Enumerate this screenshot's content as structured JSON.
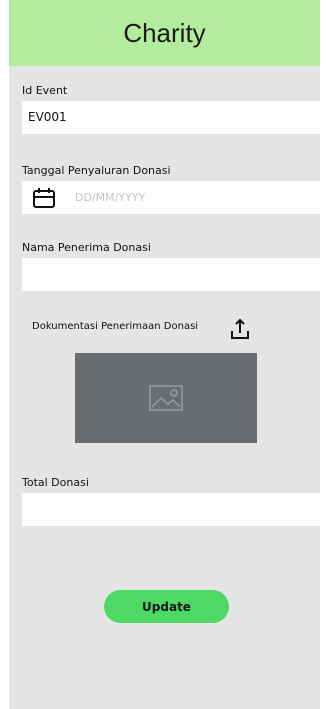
{
  "app": {
    "title": "Charity"
  },
  "form": {
    "id_event": {
      "label": "Id Event",
      "value": "EV001"
    },
    "tanggal": {
      "label": "Tanggal Penyaluran Donasi",
      "placeholder": "DD/MM/YYYY",
      "icon": "calendar-icon"
    },
    "nama_penerima": {
      "label": "Nama Penerima Donasi",
      "value": ""
    },
    "dokumentasi": {
      "label": "Dokumentasi Penerimaan Donasi",
      "upload_icon": "upload-icon",
      "image_icon": "image-placeholder-icon"
    },
    "total_donasi": {
      "label": "Total Donasi",
      "value": ""
    },
    "update_label": "Update"
  },
  "colors": {
    "header": "#b3ec9d",
    "background": "#e5e5e5",
    "button": "#4cd964",
    "image_placeholder": "#6b6e70"
  }
}
